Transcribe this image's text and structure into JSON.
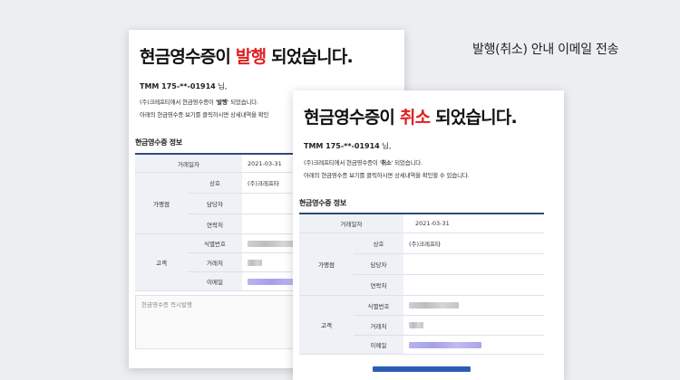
{
  "caption": "발행(취소) 안내 이메일 전송",
  "issued": {
    "title_pre": "현금영수증이 ",
    "title_hl": "발행",
    "title_post": " 되었습니다.",
    "recipient": "TMM 175-**-01914",
    "recipient_suffix": "님,",
    "line1_pre": "(주)크레프티에서 현금영수증이 '",
    "line1_bold": "발행",
    "line1_post": "' 되었습니다.",
    "line2": "아래의 현금영수증 보기를 클릭하시면 상세내역을 확인",
    "section_title": "현금영수증 정보",
    "date_label": "거래일자",
    "date_value": "2021-03-31",
    "merchant_group": "가맹점",
    "merchant_name_label": "상호",
    "merchant_name_value": "(주)크레프타",
    "merchant_manager_label": "담당자",
    "merchant_contact_label": "연락처",
    "customer_group": "고객",
    "customer_id_label": "식별번호",
    "customer_name_label": "거래처",
    "customer_email_label": "이메일",
    "memo_placeholder": "현금영수증 즉시발행"
  },
  "cancelled": {
    "title_pre": "현금영수증이 ",
    "title_hl": "취소",
    "title_post": " 되었습니다.",
    "recipient": "TMM 175-**-01914",
    "recipient_suffix": "님,",
    "line1_pre": "(주)크레프티에서 현금영수증이 '",
    "line1_bold": "취소",
    "line1_post": "' 되었습니다.",
    "line2": "아래의 현금영수증 보기를 클릭하시면 상세내역을 확인할 수 있습니다.",
    "section_title": "현금영수증 정보",
    "date_label": "거래일자",
    "date_value": "2021-03-31",
    "merchant_group": "가맹점",
    "merchant_name_label": "상호",
    "merchant_name_value": "(주)크레프타",
    "merchant_manager_label": "담당자",
    "merchant_contact_label": "연락처",
    "customer_group": "고객",
    "customer_id_label": "식별번호",
    "customer_name_label": "거래처",
    "customer_email_label": "이메일"
  },
  "colors": {
    "highlight": "#e02020",
    "table_border": "#2e4a7a",
    "button": "#2b5db8"
  }
}
